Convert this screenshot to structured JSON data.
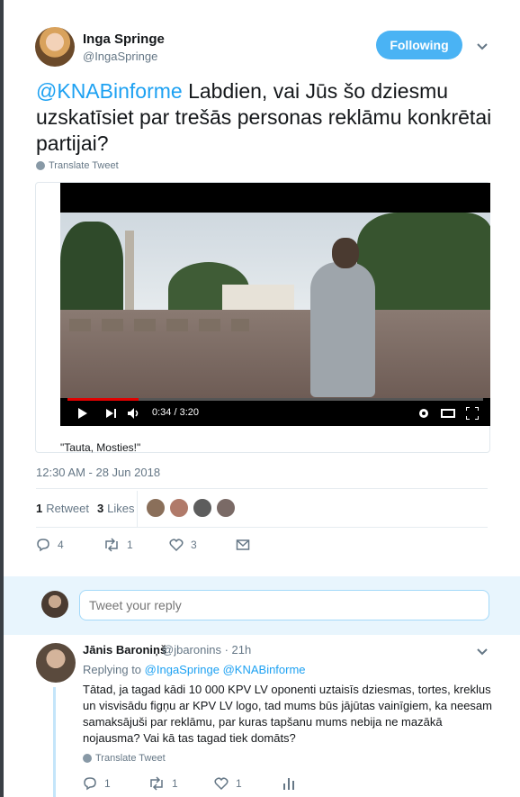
{
  "tweet": {
    "author_name": "Inga Springe",
    "author_handle": "@IngaSpringe",
    "follow_label": "Following",
    "mention": "@KNABinforme",
    "text": " Labdien, vai Jūs šo dziesmu uzskatīsiet par trešās personas reklāmu konkrētai partijai?",
    "translate_label": "Translate Tweet",
    "media": {
      "video_time": "0:34 / 3:20",
      "progress": 0.17,
      "title": "\"Tauta, Mosties!\""
    },
    "timestamp": "12:30 AM - 28 Jun 2018",
    "stats": {
      "retweets_count": "1",
      "retweets_label": "Retweet",
      "likes_count": "3",
      "likes_label": "Likes"
    },
    "actions": {
      "replies": "4",
      "retweets": "1",
      "likes": "3"
    }
  },
  "reply_box": {
    "placeholder": "Tweet your reply"
  },
  "reply": {
    "author_name": "Jānis Baroniņš",
    "author_handle": "@jbaronins · 21h",
    "replying_prefix": "Replying to",
    "replying_to": "@IngaSpringe @KNABinforme",
    "text": "Tātad, ja tagad kādi 10 000 KPV LV oponenti uztaisīs dziesmas, tortes, kreklus un visvisādu figņu ar KPV LV logo, tad mums būs jājūtas vainīgiem, ka neesam samaksājuši par reklāmu, par kuras tapšanu mums nebija ne mazākā nojausma? Vai kā tas tagad tiek domāts?",
    "translate_label": "Translate Tweet",
    "actions": {
      "replies": "1",
      "retweets": "1",
      "likes": "1"
    }
  },
  "colors": {
    "accent": "#1da1f2",
    "follow_bg": "#4ab3f4",
    "progress": "#e00000"
  }
}
